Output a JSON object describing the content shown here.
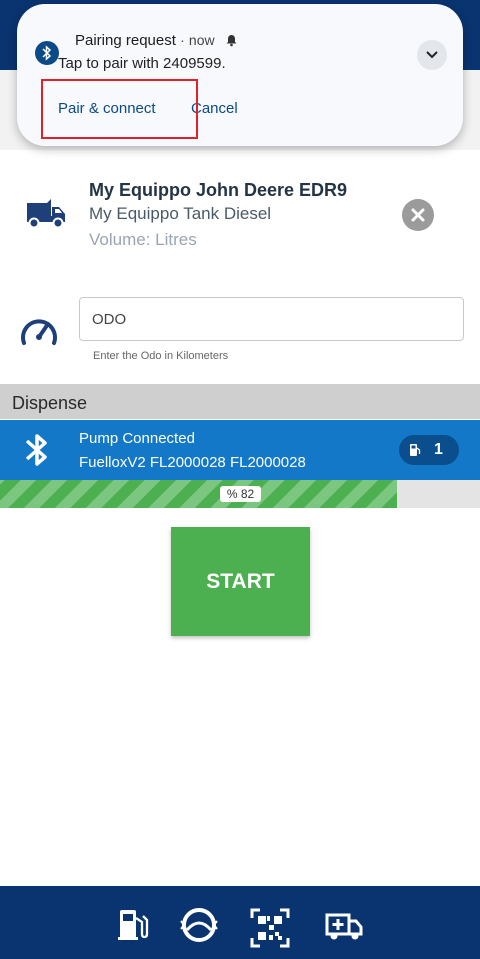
{
  "notification": {
    "title": "Pairing request",
    "separator": "·",
    "time": "now",
    "body": "Tap to pair with 2409599.",
    "actions": {
      "pair": "Pair & connect",
      "cancel": "Cancel"
    },
    "icons": {
      "app": "bluetooth-icon",
      "alert": "bell-icon",
      "expand": "chevron-down-icon"
    }
  },
  "vehicle": {
    "name": "My Equippo John Deere EDR9",
    "tank": "My Equippo Tank Diesel",
    "volume": "Volume: Litres",
    "icon": "truck-icon"
  },
  "odo": {
    "placeholder": "ODO",
    "helper": "Enter the Odo in Kilometers",
    "icon": "speedometer-icon"
  },
  "dispense": {
    "section_label": "Dispense",
    "pump_status": "Pump Connected",
    "pump_ids": "FuelloxV2 FL2000028 FL2000028",
    "badge_count": "1",
    "progress_label": "% 82",
    "progress_fraction": 0.828,
    "start_label": "START"
  },
  "bottom_nav": {
    "items": [
      "fuel-pump-icon",
      "tire-icon",
      "qr-code-icon",
      "ambulance-icon"
    ]
  },
  "colors": {
    "header": "#0a3470",
    "pump_bar": "#1378c8",
    "progress": "#4caf50",
    "start": "#4caf50",
    "highlight": "#e0202a"
  }
}
